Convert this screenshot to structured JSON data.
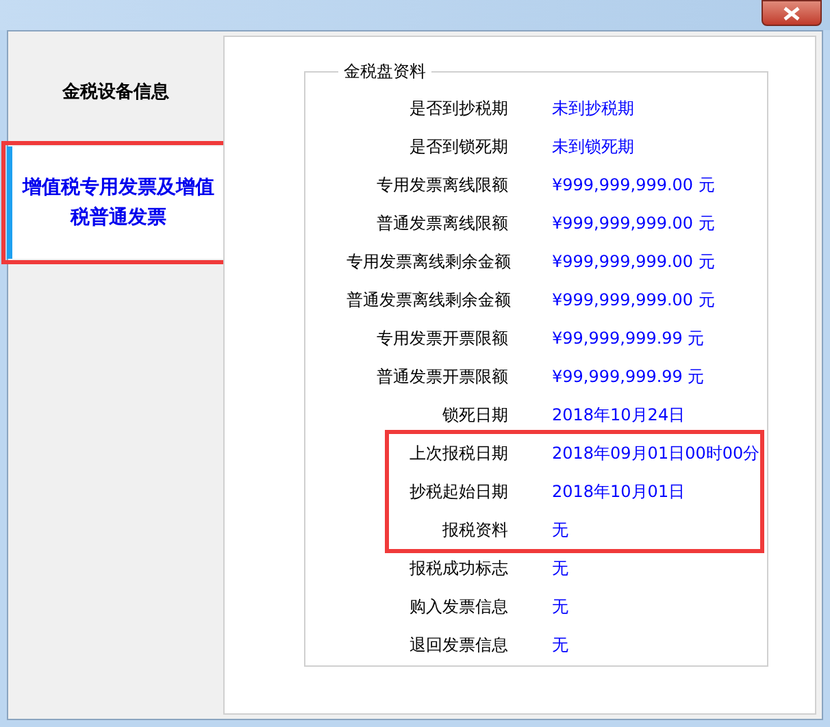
{
  "sidebar": {
    "items": [
      {
        "label": "金税设备信息",
        "selected": false,
        "highlighted": false
      },
      {
        "label": "增值税专用发票及增值税普通发票",
        "selected": true,
        "highlighted": true
      }
    ]
  },
  "panel": {
    "group_title": "金税盘资料",
    "rows": [
      {
        "label": "是否到抄税期",
        "value": "未到抄税期",
        "highlighted": false
      },
      {
        "label": "是否到锁死期",
        "value": "未到锁死期",
        "highlighted": false
      },
      {
        "label": "专用发票离线限额",
        "value": "¥999,999,999.00 元",
        "highlighted": false
      },
      {
        "label": "普通发票离线限额",
        "value": "¥999,999,999.00 元",
        "highlighted": false
      },
      {
        "label": "专用发票离线剩余金额",
        "value": "¥999,999,999.00 元",
        "highlighted": false
      },
      {
        "label": "普通发票离线剩余金额",
        "value": "¥999,999,999.00 元",
        "highlighted": false
      },
      {
        "label": "专用发票开票限额",
        "value": "¥99,999,999.99 元",
        "highlighted": false
      },
      {
        "label": "普通发票开票限额",
        "value": "¥99,999,999.99 元",
        "highlighted": false
      },
      {
        "label": "锁死日期",
        "value": "2018年10月24日",
        "highlighted": false
      },
      {
        "label": "上次报税日期",
        "value": "2018年09月01日00时00分",
        "highlighted": true
      },
      {
        "label": "抄税起始日期",
        "value": "2018年10月01日",
        "highlighted": true
      },
      {
        "label": "报税资料",
        "value": "无",
        "highlighted": true
      },
      {
        "label": "报税成功标志",
        "value": "无",
        "highlighted": false
      },
      {
        "label": "购入发票信息",
        "value": "无",
        "highlighted": false
      },
      {
        "label": "退回发票信息",
        "value": "无",
        "highlighted": false
      }
    ]
  }
}
